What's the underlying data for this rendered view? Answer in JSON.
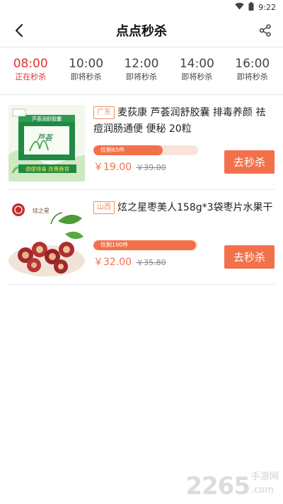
{
  "status_bar": {
    "time": "9:22",
    "icons": [
      "wifi-icon",
      "battery-icon"
    ]
  },
  "header": {
    "title": "点点秒杀",
    "back_icon": "chevron-left-icon",
    "share_icon": "share-icon"
  },
  "slots": [
    {
      "time": "08:00",
      "status": "正在秒杀",
      "active": true
    },
    {
      "time": "10:00",
      "status": "即将秒杀",
      "active": false
    },
    {
      "time": "12:00",
      "status": "即将秒杀",
      "active": false
    },
    {
      "time": "14:00",
      "status": "即将秒杀",
      "active": false
    },
    {
      "time": "16:00",
      "status": "即将秒杀",
      "active": false
    }
  ],
  "products": [
    {
      "region": "广东",
      "name": "麦荻康 芦荟润舒胶囊 排毒养颜 祛痘润肠通便 便秘 20粒",
      "remaining_text": "仅剩65件",
      "progress": 0.66,
      "price": "￥19.00",
      "original_price": "￥39.00",
      "button": "去秒杀",
      "image_box_text": "芦荟润舒胶囊",
      "image_banner_text": "通便排毒 改善肠胃"
    },
    {
      "region": "山西",
      "name": "炫之星枣美人158g*3袋枣片水果干",
      "remaining_text": "仅剩190件",
      "progress": 0.98,
      "price": "￥32.00",
      "original_price": "￥35.80",
      "button": "去秒杀",
      "image_logo_text": "炫之星"
    }
  ],
  "watermark": {
    "big": "2265",
    "small": "手游网",
    "small2": ".com"
  },
  "colors": {
    "accent": "#f2714a",
    "active_slot": "#e03131"
  }
}
